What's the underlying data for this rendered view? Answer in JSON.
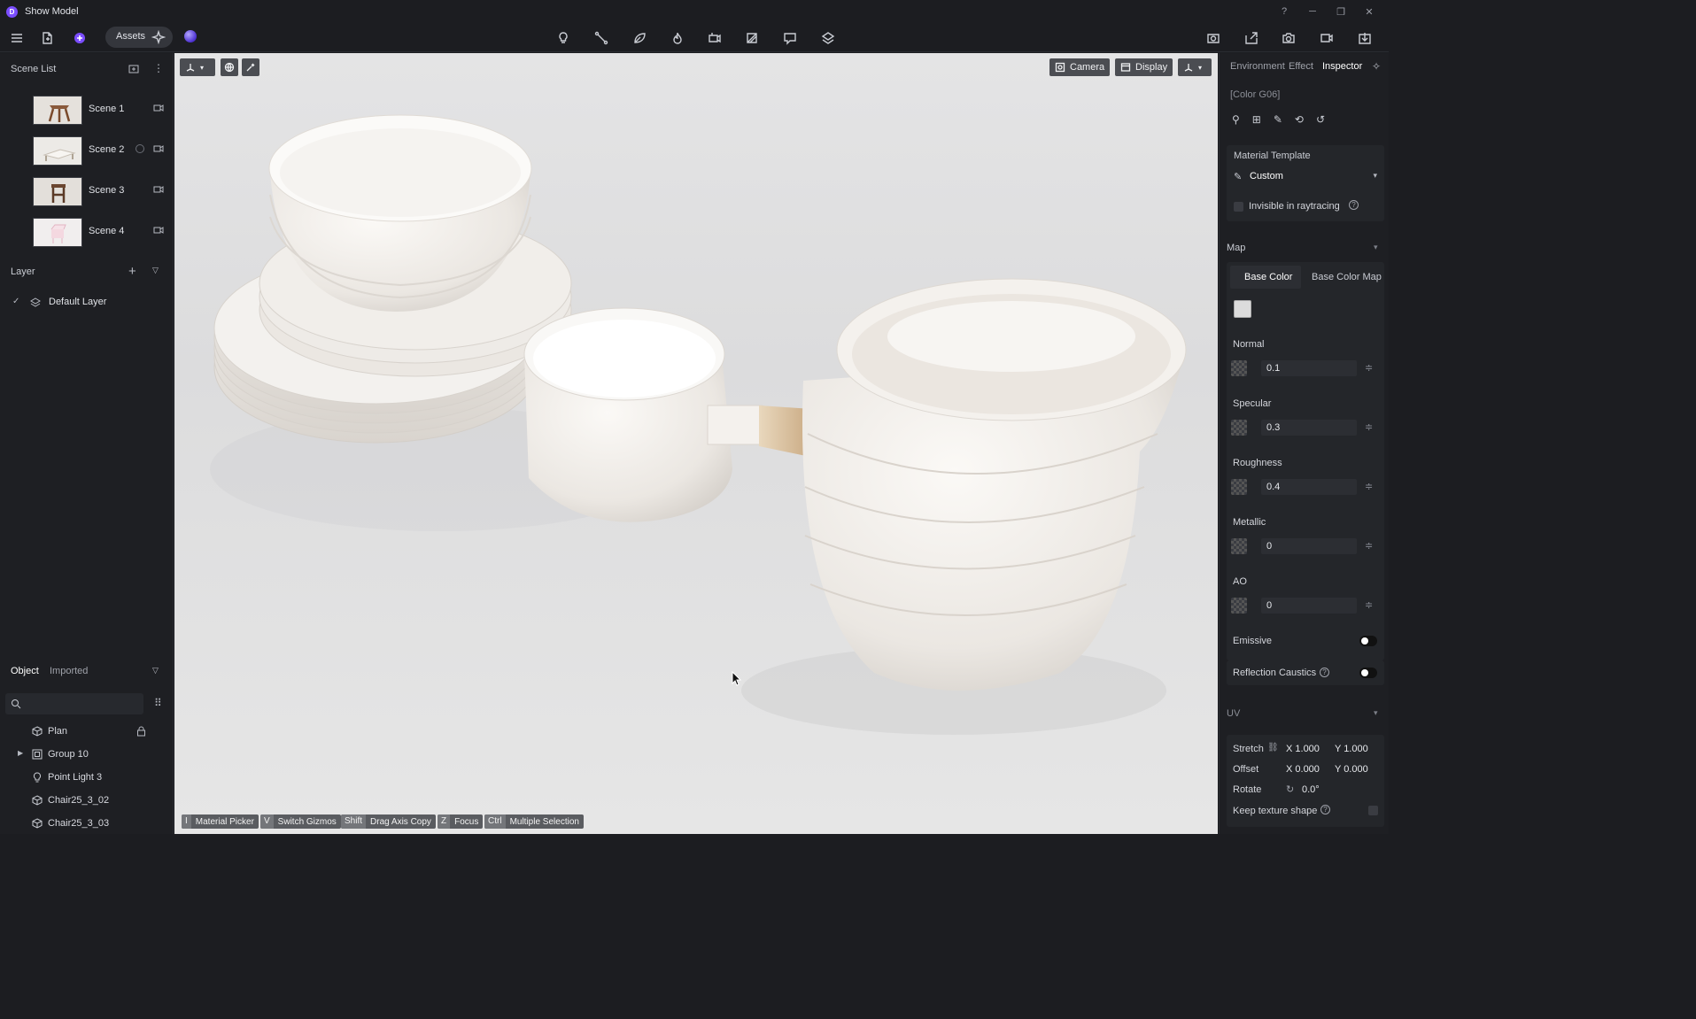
{
  "window": {
    "title": "Show Model",
    "logo_letter": "D"
  },
  "toolbar": {
    "assets_label": "Assets"
  },
  "scene_list": {
    "title": "Scene List",
    "scenes": [
      {
        "name": "Scene 1"
      },
      {
        "name": "Scene 2"
      },
      {
        "name": "Scene 3"
      },
      {
        "name": "Scene 4"
      }
    ]
  },
  "layer": {
    "title": "Layer",
    "items": [
      {
        "name": "Default Layer"
      }
    ]
  },
  "objects": {
    "tabs": [
      "Object",
      "Imported"
    ],
    "items": [
      {
        "name": "Plan"
      },
      {
        "name": "Group 10"
      },
      {
        "name": "Point Light 3"
      },
      {
        "name": "Chair25_3_02"
      },
      {
        "name": "Chair25_3_03"
      }
    ]
  },
  "viewport": {
    "buttons": {
      "camera": "Camera",
      "display": "Display"
    },
    "hints": [
      {
        "key": "I",
        "text": "Material Picker"
      },
      {
        "key": "V",
        "text": "Switch Gizmos"
      },
      {
        "key": "Shift",
        "text": "Drag Axis Copy"
      },
      {
        "key": "Z",
        "text": "Focus"
      },
      {
        "key": "Ctrl",
        "text": "Multiple Selection"
      }
    ]
  },
  "inspector": {
    "tabs": [
      "Environment",
      "Effect",
      "Inspector"
    ],
    "material_name": "[Color G06]",
    "material_template_label": "Material Template",
    "template_value": "Custom",
    "invisible_label": "Invisible in raytracing",
    "map_label": "Map",
    "base_color_tabs": [
      "Base Color",
      "Base Color Map"
    ],
    "channels": [
      {
        "label": "Normal",
        "value": "0.1"
      },
      {
        "label": "Specular",
        "value": "0.3"
      },
      {
        "label": "Roughness",
        "value": "0.4"
      },
      {
        "label": "Metallic",
        "value": "0"
      },
      {
        "label": "AO",
        "value": "0"
      }
    ],
    "emissive_label": "Emissive",
    "reflection_label": "Reflection Caustics",
    "uv_label": "UV",
    "stretch": {
      "label": "Stretch",
      "x": "X 1.000",
      "y": "Y 1.000"
    },
    "offset": {
      "label": "Offset",
      "x": "X 0.000",
      "y": "Y 0.000"
    },
    "rotate": {
      "label": "Rotate",
      "value": "0.0°"
    },
    "keep_texture_label": "Keep texture shape"
  },
  "colors": {
    "accent": "#7b4dff",
    "panel": "#1e1f23",
    "viewport": "#e2e2e3"
  }
}
